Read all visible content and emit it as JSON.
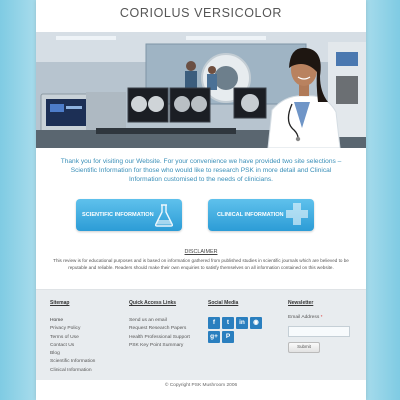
{
  "header": {
    "title": "CORIOLUS VERSICOLOR"
  },
  "intro": {
    "text": "Thank you for visiting our Website. For your convenience we have provided two site selections – Scientific Information for those who would like to research PSK in more detail and Clinical Information customised to the needs of clinicians."
  },
  "buttons": {
    "scientific": {
      "label": "SCIENTIFIC INFORMATION",
      "icon": "flask-icon"
    },
    "clinical": {
      "label": "CLINICAL INFORMATION",
      "icon": "medical-cross-icon"
    }
  },
  "disclaimer": {
    "heading": "DISCLAIMER",
    "text": "This review is for educational purposes and is based on information gathered from published studies in scientific journals which are believed to be reputable and reliable. Readers should make their own enquiries to satisfy themselves on all information contained on this website."
  },
  "footer": {
    "sitemap": {
      "heading": "Sitemap",
      "items": [
        "Home",
        "Privacy Policy",
        "Terms of Use",
        "Contact Us",
        "Blog",
        "Scientific Information",
        "Clinical Information"
      ]
    },
    "quick_links": {
      "heading": "Quick Access Links",
      "items": [
        "Send us an email",
        "Request Research Papers",
        "Health Professional Support",
        "PSK Key Point Summary"
      ]
    },
    "social": {
      "heading": "Social Media",
      "icons": [
        {
          "name": "facebook-icon",
          "glyph": "f"
        },
        {
          "name": "twitter-icon",
          "glyph": "t"
        },
        {
          "name": "linkedin-icon",
          "glyph": "in"
        },
        {
          "name": "rss-icon",
          "glyph": "◉"
        },
        {
          "name": "google-plus-icon",
          "glyph": "g+"
        },
        {
          "name": "pinterest-icon",
          "glyph": "P"
        }
      ]
    },
    "newsletter": {
      "heading": "Newsletter",
      "label": "Email Address",
      "required": "*",
      "input_value": "",
      "button": "Submit"
    },
    "copyright": "© Copyright PSK Mushroom 2006"
  },
  "colors": {
    "accent": "#3a8fb8",
    "button": "#2c9cd6",
    "footer_bg": "#e8ecef",
    "social": "#2a7fbf"
  }
}
